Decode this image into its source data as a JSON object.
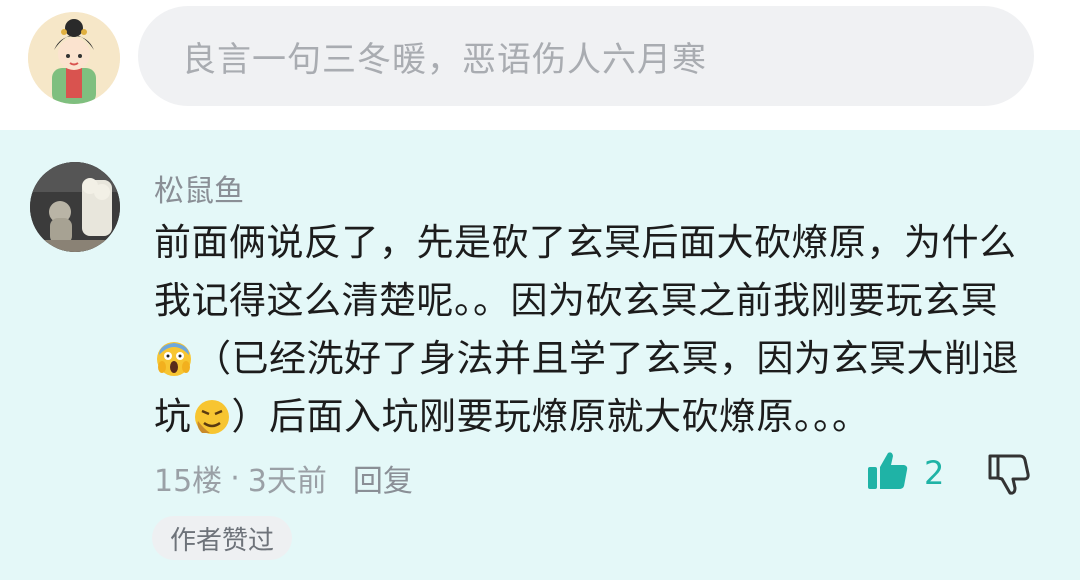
{
  "input": {
    "placeholder": "良言一句三冬暖，恶语伤人六月寒"
  },
  "comment": {
    "username": "松鼠鱼",
    "text_part1": "前面俩说反了，先是砍了玄冥后面大砍燎原，为什么我记得这么清楚呢。。因为砍玄冥之前我刚要玩玄冥",
    "emoji1": "scream-emoji",
    "text_part2": "（已经洗好了身法并且学了玄冥，因为玄冥大削退坑",
    "emoji2": "confounded-emoji",
    "text_part3": "）后面入坑刚要玩燎原就大砍燎原。。。",
    "floor": "15楼",
    "dot": "·",
    "time": "3天前",
    "reply_label": "回复",
    "like_count": "2",
    "badge": "作者赞过"
  },
  "colors": {
    "card_bg": "#e4f8f8",
    "accent": "#1fb3a6",
    "input_bg": "#f0f1f3"
  }
}
